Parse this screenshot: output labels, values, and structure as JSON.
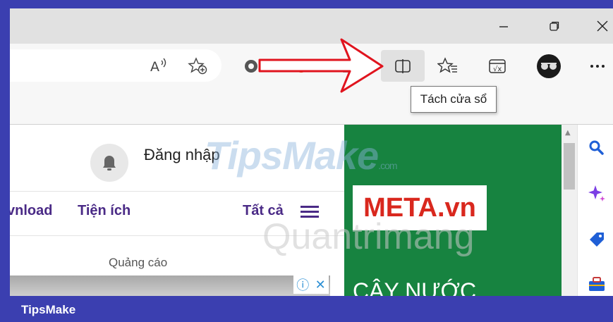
{
  "toolbar": {
    "split_screen_tooltip": "Tách cửa sổ"
  },
  "page": {
    "login_label": "Đăng nhập",
    "nav": {
      "items": [
        "vnload",
        "Tiện ích"
      ],
      "all_label": "Tất cả"
    },
    "ad_label": "Quảng cáo",
    "ad_icons": [
      "ⓘ",
      "✕"
    ],
    "banner": {
      "brand": "META.vn",
      "tagline": "CÂY NƯỚC"
    }
  },
  "watermarks": {
    "tipsmake": "TipsMake",
    "tipsmake_suffix": ".com",
    "quantrimang": "Quantrimang"
  },
  "footer": {
    "label": "TipsMake"
  },
  "colors": {
    "frame": "#3b3fb0",
    "nav_purple": "#4a2a86",
    "banner_green": "#178340",
    "brand_red": "#d9281e",
    "arrow_red": "#e0141e"
  },
  "icons": [
    "minimize-icon",
    "restore-icon",
    "close-icon",
    "read-aloud-icon",
    "add-favorite-icon",
    "extension-gear-icon",
    "extension-orange-icon",
    "puzzle-icon",
    "split-screen-icon",
    "favorites-icon",
    "math-solver-icon",
    "profile-avatar-icon",
    "more-icon",
    "bell-icon",
    "hamburger-icon",
    "search-icon",
    "sparkle-icon",
    "tag-icon",
    "toolbox-icon"
  ]
}
